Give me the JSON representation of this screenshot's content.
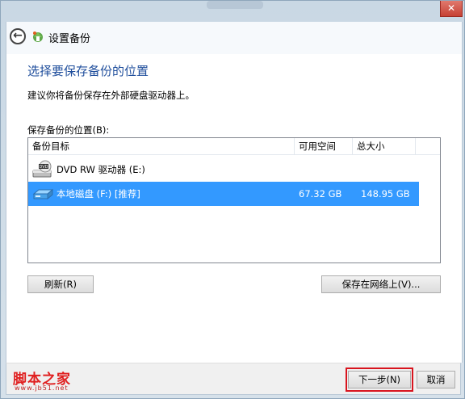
{
  "window": {
    "close_glyph": "✕"
  },
  "header": {
    "title": "设置备份",
    "back_glyph": "←"
  },
  "main": {
    "heading": "选择要保存备份的位置",
    "subtext": "建议你将备份保存在外部硬盘驱动器上。",
    "location_label": "保存备份的位置(B):",
    "columns": [
      "备份目标",
      "可用空间",
      "总大小"
    ],
    "drives": [
      {
        "name": "DVD RW 驱动器 (E:)",
        "free": "",
        "total": "",
        "icon": "dvd-drive-icon",
        "selected": false
      },
      {
        "name": "本地磁盘 (F:) [推荐]",
        "free": "67.32 GB",
        "total": "148.95 GB",
        "icon": "hard-disk-icon",
        "selected": true
      }
    ],
    "refresh_label": "刷新(R)",
    "save_network_label": "保存在网络上(V)..."
  },
  "footer": {
    "next_label": "下一步(N)",
    "cancel_label": "取消",
    "watermark_text": "脚本之家",
    "watermark_url": "www.jb51.net"
  },
  "colors": {
    "accent_heading": "#1f4e9c",
    "selection": "#3399ff",
    "highlight_box": "#d8141e",
    "close_button": "#c64134"
  }
}
